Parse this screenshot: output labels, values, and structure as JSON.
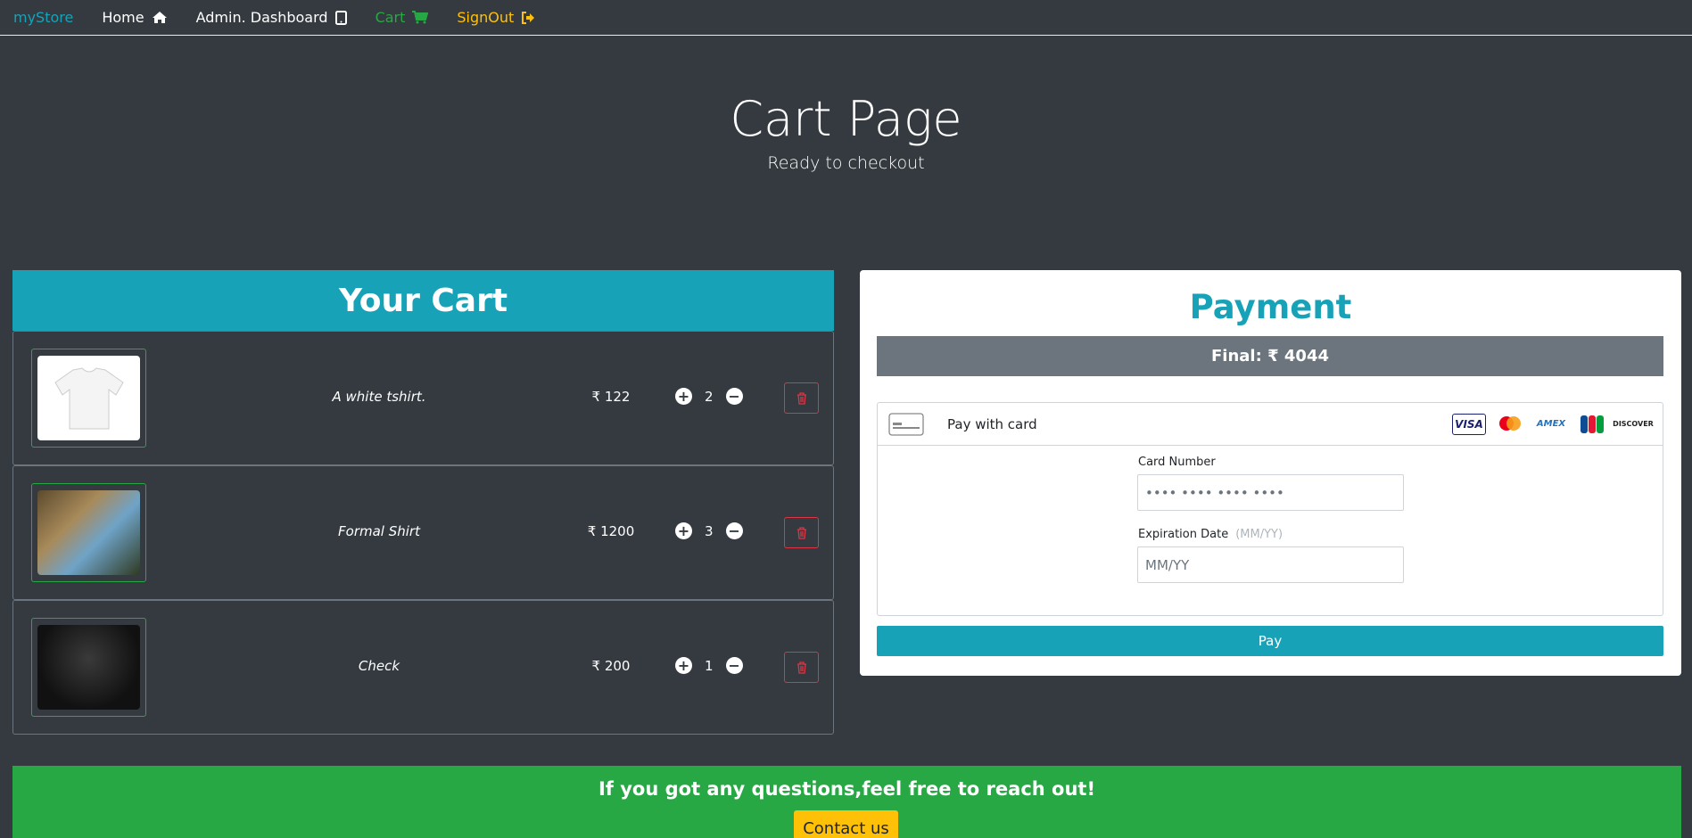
{
  "navbar": {
    "brand": "myStore",
    "links": [
      {
        "label": "Home",
        "icon": "home-icon"
      },
      {
        "label": "Admin. Dashboard",
        "icon": "tablet-icon"
      },
      {
        "label": "Cart",
        "icon": "cart-icon"
      },
      {
        "label": "SignOut",
        "icon": "sign-out-icon"
      }
    ]
  },
  "hero": {
    "title": "Cart Page",
    "subtitle": "Ready to checkout"
  },
  "cart": {
    "header": "Your Cart",
    "currency_symbol": "₹",
    "items": [
      {
        "name": "A white tshirt.",
        "price": "122",
        "qty": "2",
        "image": "white-tshirt-image"
      },
      {
        "name": "Formal Shirt",
        "price": "1200",
        "qty": "3",
        "image": "formal-shirt-image"
      },
      {
        "name": "Check",
        "price": "200",
        "qty": "1",
        "image": "check-shirt-image"
      }
    ]
  },
  "payment": {
    "title": "Payment",
    "final_label": "Final:",
    "final_amount": "4044",
    "pay_with_card": "Pay with card",
    "card_brands": [
      "VISA",
      "mastercard",
      "AMEX",
      "JCB",
      "DISCOVER"
    ],
    "card_number_label": "Card Number",
    "card_number_placeholder": "•••• •••• •••• ••••",
    "expiration_label": "Expiration Date",
    "expiration_hint": "(MM/YY)",
    "expiration_placeholder": "MM/YY",
    "pay_button": "Pay"
  },
  "footer": {
    "text": "If you got any questions,feel free to reach out!",
    "contact_button": "Contact us"
  },
  "colors": {
    "background": "#343a40",
    "info": "#17a2b8",
    "success": "#28a745",
    "warning": "#ffc107",
    "danger": "#dc3545",
    "secondary": "#6c757d"
  }
}
